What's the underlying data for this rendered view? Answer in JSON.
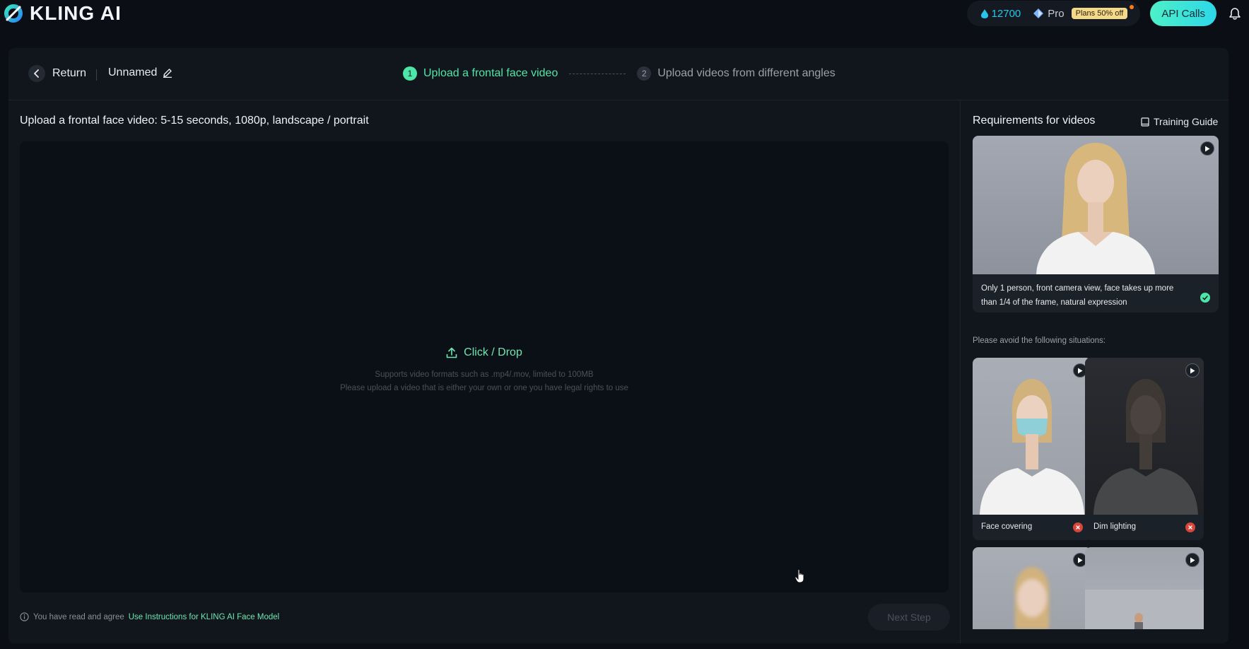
{
  "brand": {
    "name": "KLING AI"
  },
  "topbar": {
    "credits": "12700",
    "plan": "Pro",
    "plans_badge": "Plans 50% off",
    "api_button": "API Calls"
  },
  "header": {
    "return_label": "Return",
    "project_name": "Unnamed",
    "steps": [
      {
        "num": "1",
        "label": "Upload a frontal face video",
        "state": "active"
      },
      {
        "num": "2",
        "label": "Upload videos from different angles",
        "state": "inactive"
      }
    ]
  },
  "upload": {
    "title": "Upload a frontal face video: 5-15 seconds, 1080p, landscape / portrait",
    "action": "Click / Drop",
    "formats": "Supports video formats such as .mp4/.mov, limited to 100MB",
    "rights": "Please upload a video that is either your own or one you have legal rights to use"
  },
  "footer": {
    "agree_text": "You have read and agree",
    "agree_link": "Use Instructions for KLING AI Face Model",
    "next_button": "Next Step"
  },
  "sidebar": {
    "title": "Requirements for videos",
    "guide": "Training Guide",
    "good_example": "Only 1 person, front camera view, face takes up more than 1/4 of the frame, natural expression",
    "avoid_title": "Please avoid the following situations:",
    "bad_examples": [
      {
        "label": "Face covering"
      },
      {
        "label": "Dim lighting"
      }
    ]
  },
  "colors": {
    "accent_green": "#4ee6a8",
    "accent_cyan": "#27c6e8",
    "error_red": "#d8453a",
    "background": "#0b0e14"
  }
}
